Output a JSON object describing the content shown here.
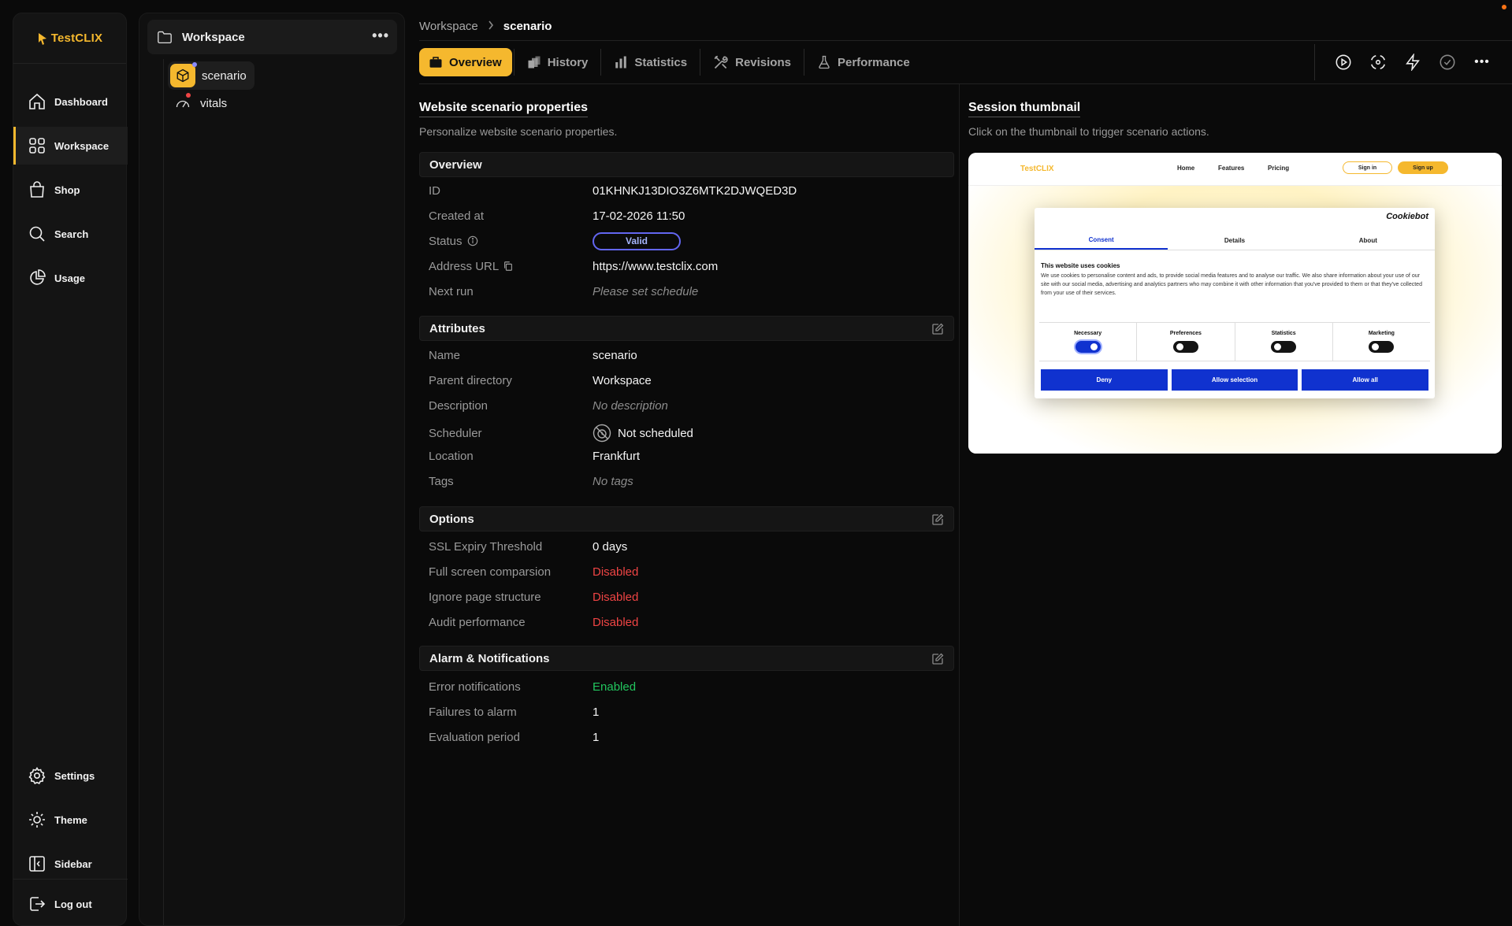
{
  "app": {
    "logo_text": "TestCLIX"
  },
  "nav": {
    "items": [
      {
        "id": "dashboard",
        "label": "Dashboard",
        "icon": "home-icon"
      },
      {
        "id": "workspace",
        "label": "Workspace",
        "icon": "grid-icon",
        "active": true
      },
      {
        "id": "shop",
        "label": "Shop",
        "icon": "bag-icon"
      },
      {
        "id": "search",
        "label": "Search",
        "icon": "search-icon"
      },
      {
        "id": "usage",
        "label": "Usage",
        "icon": "pie-chart-icon"
      }
    ],
    "bottom": [
      {
        "id": "settings",
        "label": "Settings",
        "icon": "gear-icon"
      },
      {
        "id": "theme",
        "label": "Theme",
        "icon": "sun-icon"
      },
      {
        "id": "sidebar",
        "label": "Sidebar",
        "icon": "sidebar-icon"
      },
      {
        "id": "logout",
        "label": "Log out",
        "icon": "logout-icon"
      }
    ]
  },
  "tree": {
    "header": "Workspace",
    "items": [
      {
        "label": "scenario",
        "icon": "cube-icon",
        "selected": true
      },
      {
        "label": "vitals",
        "icon": "gauge-icon"
      }
    ]
  },
  "breadcrumb": {
    "root": "Workspace",
    "current": "scenario"
  },
  "tabs": [
    {
      "label": "Overview",
      "icon": "briefcase-icon",
      "active": true
    },
    {
      "label": "History",
      "icon": "history-icon"
    },
    {
      "label": "Statistics",
      "icon": "bar-chart-icon"
    },
    {
      "label": "Revisions",
      "icon": "tools-icon"
    },
    {
      "label": "Performance",
      "icon": "flask-icon"
    }
  ],
  "actions": [
    "play-icon",
    "focus-icon",
    "bolt-icon",
    "check-circle-icon",
    "more-icon"
  ],
  "properties": {
    "title": "Website scenario properties",
    "subtitle": "Personalize website scenario properties.",
    "overview": {
      "heading": "Overview",
      "id_label": "ID",
      "id_value": "01KHNKJ13DIO3Z6MTK2DJWQED3D",
      "created_label": "Created at",
      "created_value": "17-02-2026 11:50",
      "status_label": "Status",
      "status_value": "Valid",
      "url_label": "Address URL",
      "url_value": "https://www.testclix.com",
      "next_label": "Next run",
      "next_value": "Please set schedule"
    },
    "attributes": {
      "heading": "Attributes",
      "name_label": "Name",
      "name_value": "scenario",
      "parent_label": "Parent directory",
      "parent_value": "Workspace",
      "desc_label": "Description",
      "desc_value": "No description",
      "sched_label": "Scheduler",
      "sched_value": "Not scheduled",
      "loc_label": "Location",
      "loc_value": "Frankfurt",
      "tags_label": "Tags",
      "tags_value": "No tags"
    },
    "options": {
      "heading": "Options",
      "ssl_label": "SSL Expiry Threshold",
      "ssl_value": "0 days",
      "full_label": "Full screen comparsion",
      "full_value": "Disabled",
      "ignore_label": "Ignore page structure",
      "ignore_value": "Disabled",
      "audit_label": "Audit performance",
      "audit_value": "Disabled"
    },
    "alarm": {
      "heading": "Alarm & Notifications",
      "err_label": "Error notifications",
      "err_value": "Enabled",
      "fail_label": "Failures to alarm",
      "fail_value": "1",
      "eval_label": "Evaluation period",
      "eval_value": "1"
    }
  },
  "thumbnail": {
    "title": "Session thumbnail",
    "subtitle": "Click on the thumbnail to trigger scenario actions.",
    "site": {
      "logo": "TestCLIX",
      "links": [
        "Home",
        "Features",
        "Pricing"
      ],
      "sign_in": "Sign in",
      "sign_up": "Sign up"
    },
    "cookie": {
      "brand": "Cookiebot",
      "tabs": [
        "Consent",
        "Details",
        "About"
      ],
      "heading": "This website uses cookies",
      "body": "We use cookies to personalise content and ads, to provide social media features and to analyse our traffic. We also share information about your use of our site with our social media, advertising and analytics partners who may combine it with other information that you've provided to them or that they've collected from your use of their services.",
      "toggles": [
        "Necessary",
        "Preferences",
        "Statistics",
        "Marketing"
      ],
      "buttons": [
        "Deny",
        "Allow selection",
        "Allow all"
      ]
    }
  },
  "colors": {
    "accent": "#f5b82e",
    "danger": "#ef4444",
    "success": "#22c55e",
    "valid": "#6366f1"
  }
}
